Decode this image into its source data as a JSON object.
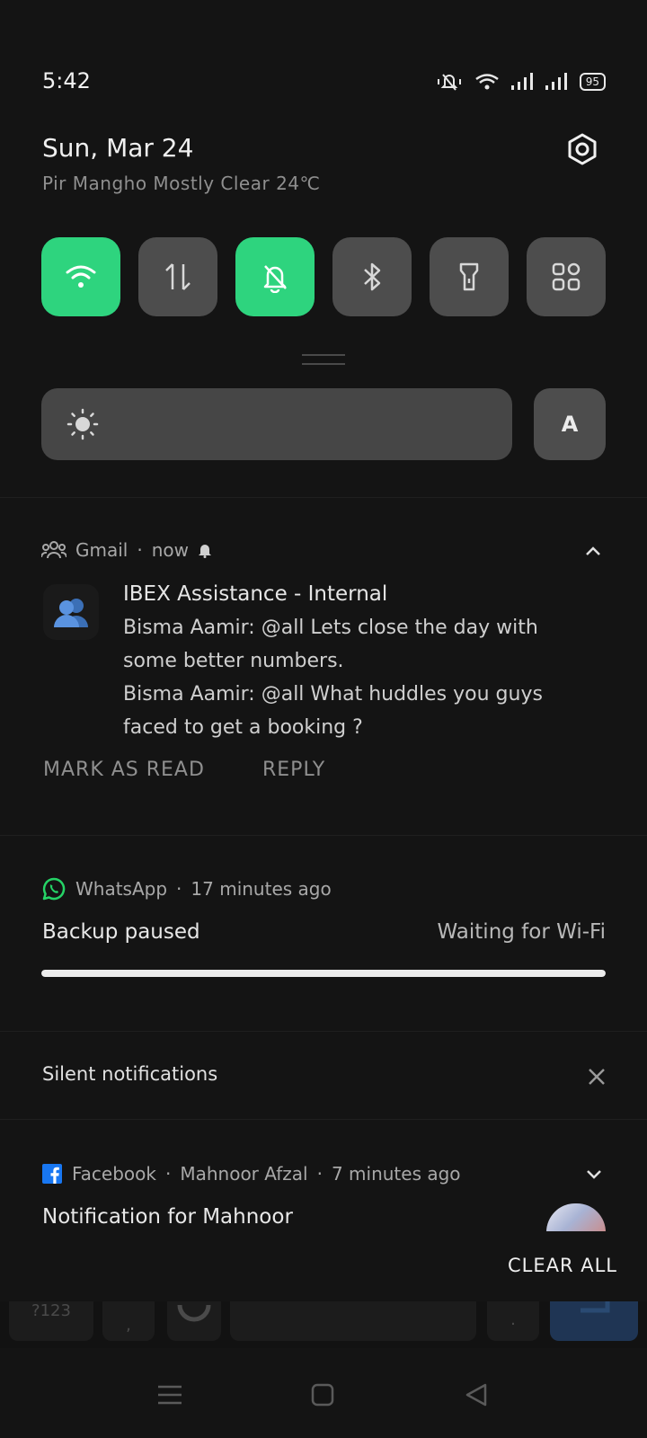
{
  "status_bar": {
    "time": "5:42",
    "battery": "95"
  },
  "header": {
    "date": "Sun, Mar 24",
    "weather": "Pir Mangho Mostly Clear 24℃"
  },
  "brightness": {
    "auto_label": "A"
  },
  "gmail": {
    "app": "Gmail",
    "time": "now",
    "title": "IBEX Assistance - Internal",
    "lines": [
      "Bisma Aamir: @all Lets close the day with some better numbers.",
      "Bisma Aamir: @all What huddles you guys faced to get a booking ?"
    ],
    "actions": {
      "mark_read": "MARK AS READ",
      "reply": "REPLY"
    }
  },
  "whatsapp": {
    "app": "WhatsApp",
    "time": "17 minutes ago",
    "title": "Backup paused",
    "status": "Waiting for Wi-Fi",
    "progress": 1.0
  },
  "silent": {
    "label": "Silent notifications"
  },
  "facebook": {
    "app": "Facebook",
    "account": "Mahnoor Afzal",
    "time": "7 minutes ago",
    "title": "Notification for Mahnoor"
  },
  "clear_all": "CLEAR ALL",
  "keyboard": {
    "numbers_key": "?123",
    "comma_key": ",",
    "period_key": "."
  },
  "colors": {
    "accent": "#2ed47e",
    "tile_off": "#4d4d4d",
    "background": "#141414",
    "facebook": "#1877f2",
    "whatsapp": "#25d366"
  }
}
